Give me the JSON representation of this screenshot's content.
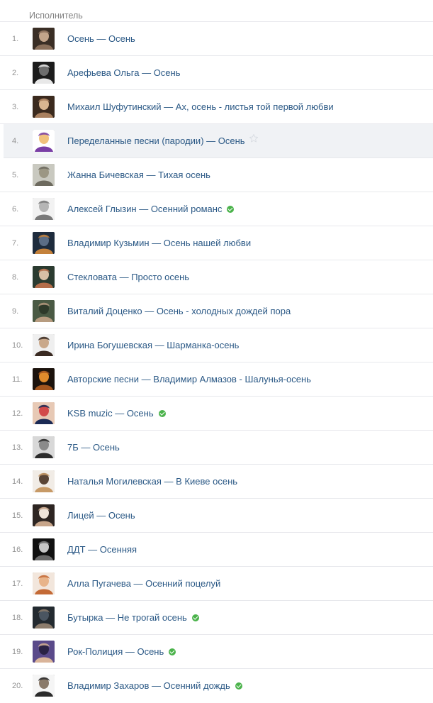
{
  "header": {
    "label": "Исполнитель"
  },
  "rows": [
    {
      "num": "1.",
      "artist": "Осень",
      "title": "Осень",
      "verified": false,
      "colors": [
        "#3a2e25",
        "#8a6f5a",
        "#c2a48a"
      ]
    },
    {
      "num": "2.",
      "artist": "Арефьева Ольга",
      "title": "Осень",
      "verified": false,
      "colors": [
        "#1c1c1c",
        "#e8e8e8",
        "#6d6d6d"
      ]
    },
    {
      "num": "3.",
      "artist": "Михаил Шуфутинский",
      "title": "Ах, осень - листья той первой любви",
      "verified": false,
      "colors": [
        "#3b2a1e",
        "#a9805f",
        "#d9b590"
      ]
    },
    {
      "num": "4.",
      "artist": "Переделанные песни (пародии)",
      "title": "Осень",
      "verified": false,
      "star": true,
      "colors": [
        "#ffffff",
        "#7a3fa6",
        "#f1c27d"
      ]
    },
    {
      "num": "5.",
      "artist": "Жанна Бичевская",
      "title": "Тихая осень",
      "verified": false,
      "colors": [
        "#c9c9c0",
        "#6d6a5e",
        "#9c9784"
      ]
    },
    {
      "num": "6.",
      "artist": "Алексей Глызин",
      "title": "Осенний романс",
      "verified": true,
      "colors": [
        "#f2f2f2",
        "#7a7a7a",
        "#b5b5b5"
      ]
    },
    {
      "num": "7.",
      "artist": "Владимир Кузьмин",
      "title": "Осень нашей любви",
      "verified": false,
      "colors": [
        "#1e2c3d",
        "#c4813b",
        "#5b6d85"
      ]
    },
    {
      "num": "8.",
      "artist": "Стекловата",
      "title": "Просто осень",
      "verified": false,
      "colors": [
        "#2b3b30",
        "#b46d4a",
        "#d9c0a5"
      ]
    },
    {
      "num": "9.",
      "artist": "Виталий Доценко",
      "title": "Осень - холодных дождей пора",
      "verified": false,
      "colors": [
        "#4a5a44",
        "#b79c80",
        "#2e3a2a"
      ]
    },
    {
      "num": "10.",
      "artist": "Ирина Богушевская",
      "title": "Шарманка-осень",
      "verified": false,
      "colors": [
        "#efefef",
        "#3a2a22",
        "#c9a88a"
      ]
    },
    {
      "num": "11.",
      "artist": "Авторские песни",
      "title": "Владимир Алмазов - Шалунья-осень",
      "verified": false,
      "colors": [
        "#1b120c",
        "#a3551e",
        "#e08b2c"
      ]
    },
    {
      "num": "12.",
      "artist": "KSB muzic",
      "title": "Осень",
      "verified": true,
      "colors": [
        "#e7c9b5",
        "#1b2a55",
        "#d24a4a"
      ]
    },
    {
      "num": "13.",
      "artist": "7Б",
      "title": "Осень",
      "verified": false,
      "colors": [
        "#d8d8d8",
        "#2c2c2c",
        "#8a8a8a"
      ]
    },
    {
      "num": "14.",
      "artist": "Наталья Могилевская",
      "title": "В Киеве осень",
      "verified": false,
      "colors": [
        "#f1ece6",
        "#c79a67",
        "#5a4536"
      ]
    },
    {
      "num": "15.",
      "artist": "Лицей",
      "title": "Осень",
      "verified": false,
      "colors": [
        "#2d2522",
        "#c7a58a",
        "#efe4da"
      ]
    },
    {
      "num": "16.",
      "artist": "ДДТ",
      "title": "Осенняя",
      "verified": false,
      "colors": [
        "#101010",
        "#6a6a6a",
        "#c6c6c6"
      ]
    },
    {
      "num": "17.",
      "artist": "Алла Пугачева",
      "title": "Осенний поцелуй",
      "verified": false,
      "colors": [
        "#f2e6dc",
        "#c46a36",
        "#e8b48a"
      ]
    },
    {
      "num": "18.",
      "artist": "Бутырка",
      "title": "Не трогай осень",
      "verified": true,
      "colors": [
        "#232a30",
        "#8c7c6c",
        "#4a5561"
      ]
    },
    {
      "num": "19.",
      "artist": "Рок-Полиция",
      "title": "Осень",
      "verified": true,
      "colors": [
        "#5a4a8a",
        "#d9b49a",
        "#2a2244"
      ]
    },
    {
      "num": "20.",
      "artist": "Владимир Захаров",
      "title": "Осенний дождь",
      "verified": true,
      "colors": [
        "#f5f5f5",
        "#2b2b2b",
        "#8a7a6a"
      ]
    }
  ],
  "hovered_row_num": "4.",
  "separator": " — "
}
